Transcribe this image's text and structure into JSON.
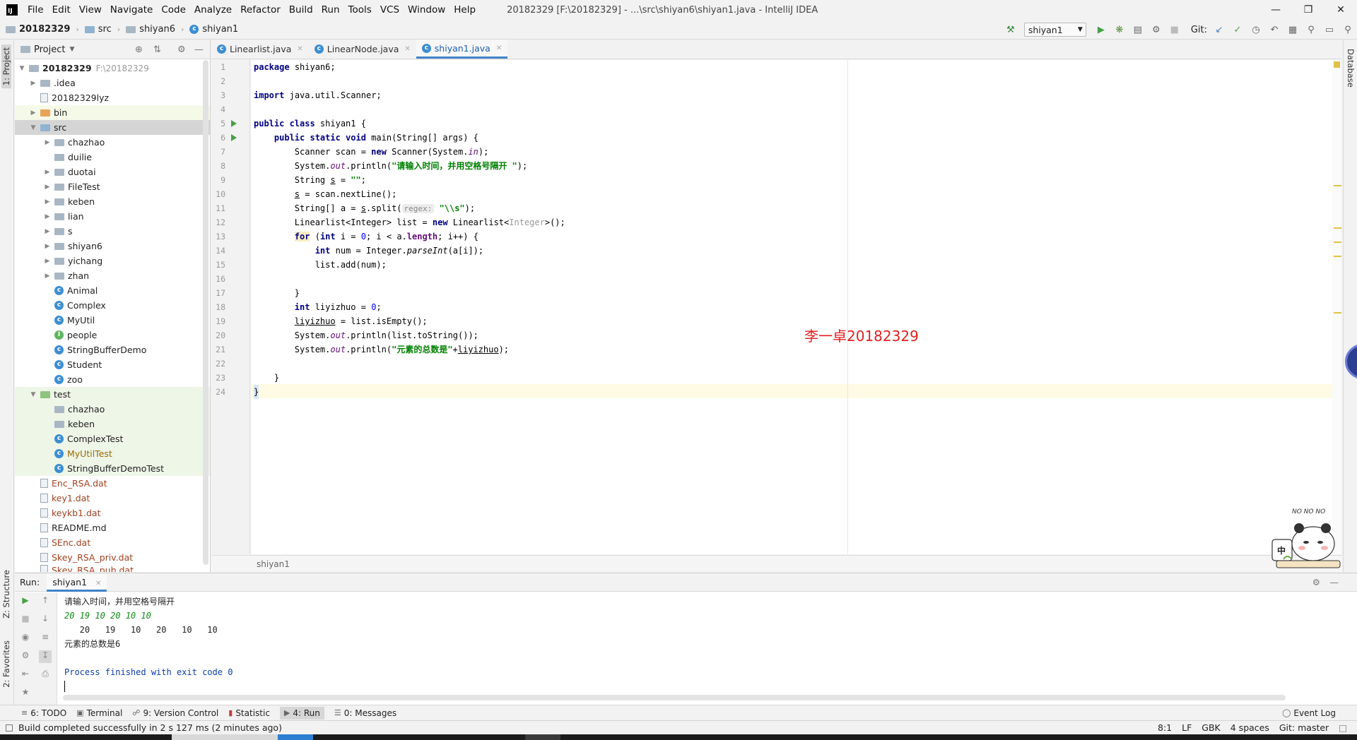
{
  "titlebar": {
    "menu": [
      "File",
      "Edit",
      "View",
      "Navigate",
      "Code",
      "Analyze",
      "Refactor",
      "Build",
      "Run",
      "Tools",
      "VCS",
      "Window",
      "Help"
    ],
    "window_title": "20182329 [F:\\20182329] - ...\\src\\shiyan6\\shiyan1.java - IntelliJ IDEA",
    "logo": "IJ"
  },
  "navbar": {
    "crumbs": [
      "20182329",
      "src",
      "shiyan6",
      "shiyan1"
    ],
    "run_config": "shiyan1",
    "git_label": "Git:"
  },
  "left_stripe": {
    "project_tab": "1: Project",
    "structure_tab": "Z: Structure",
    "favorites_tab": "2: Favorites"
  },
  "right_stripe": {
    "database_tab": "Database"
  },
  "project": {
    "title": "Project",
    "root": "20182329",
    "root_path": "F:\\20182329",
    "items": [
      {
        "label": ".idea",
        "type": "folder"
      },
      {
        "label": "20182329lyz",
        "type": "file"
      },
      {
        "label": "bin",
        "type": "folder-orange"
      },
      {
        "label": "src",
        "type": "folder"
      },
      {
        "label": "chazhao",
        "type": "package"
      },
      {
        "label": "duilie",
        "type": "package"
      },
      {
        "label": "duotai",
        "type": "package"
      },
      {
        "label": "FileTest",
        "type": "package"
      },
      {
        "label": "keben",
        "type": "package"
      },
      {
        "label": "lian",
        "type": "package"
      },
      {
        "label": "s",
        "type": "package"
      },
      {
        "label": "shiyan6",
        "type": "package"
      },
      {
        "label": "yichang",
        "type": "package"
      },
      {
        "label": "zhan",
        "type": "package"
      },
      {
        "label": "Animal",
        "type": "class"
      },
      {
        "label": "Complex",
        "type": "class"
      },
      {
        "label": "MyUtil",
        "type": "class"
      },
      {
        "label": "people",
        "type": "interface"
      },
      {
        "label": "StringBufferDemo",
        "type": "class"
      },
      {
        "label": "Student",
        "type": "class"
      },
      {
        "label": "zoo",
        "type": "class"
      },
      {
        "label": "test",
        "type": "folder-green"
      },
      {
        "label": "chazhao",
        "type": "package"
      },
      {
        "label": "keben",
        "type": "package"
      },
      {
        "label": "ComplexTest",
        "type": "class"
      },
      {
        "label": "MyUtilTest",
        "type": "class"
      },
      {
        "label": "StringBufferDemoTest",
        "type": "class"
      },
      {
        "label": "Enc_RSA.dat",
        "type": "datfile"
      },
      {
        "label": "key1.dat",
        "type": "datfile"
      },
      {
        "label": "keykb1.dat",
        "type": "datfile"
      },
      {
        "label": "README.md",
        "type": "mdfile"
      },
      {
        "label": "SEnc.dat",
        "type": "datfile"
      },
      {
        "label": "Skey_RSA_priv.dat",
        "type": "datfile"
      },
      {
        "label": "Skey_RSA_pub.dat",
        "type": "datfile"
      }
    ]
  },
  "editor": {
    "tabs": [
      "Linearlist.java",
      "LinearNode.java",
      "shiyan1.java"
    ],
    "active_tab": "shiyan1.java",
    "breadcrumb": "shiyan1",
    "watermark": "李一卓20182329",
    "line_numbers": [
      "1",
      "2",
      "3",
      "4",
      "5",
      "6",
      "7",
      "8",
      "9",
      "10",
      "11",
      "12",
      "13",
      "14",
      "15",
      "16",
      "17",
      "18",
      "19",
      "20",
      "21",
      "22",
      "23",
      "24"
    ],
    "code": {
      "l1": "package shiyan6;",
      "l3": "import java.util.Scanner;",
      "l5a": "public class ",
      "l5b": "shiyan1 {",
      "l6a": "    public static void ",
      "l6b": "main(String[] args) {",
      "l7a": "        Scanner scan = ",
      "l7b": "new",
      "l7c": " Scanner(System.",
      "l7d": "in",
      "l7e": ");",
      "l8a": "        System.",
      "l8b": "out",
      "l8c": ".println(",
      "l8d": "\"请输入时间，并用空格号隔开 \"",
      "l8e": ");",
      "l9a": "        String ",
      "l9b": "s",
      "l9c": " = ",
      "l9d": "\"\"",
      "l9e": ";",
      "l10a": "        ",
      "l10b": "s",
      "l10c": " = scan.nextLine();",
      "l11a": "        String[] a = ",
      "l11b": "s",
      "l11c": ".split(",
      "l11d": "regex:",
      "l11e": "\"\\\\s\"",
      "l11f": ");",
      "l12a": "        Linearlist<Integer> list = ",
      "l12b": "new",
      "l12c": " Linearlist<",
      "l12d": "Integer",
      "l12e": ">();",
      "l13a": "        ",
      "l13b": "for",
      "l13c": " (",
      "l13d": "int",
      "l13e": " i = ",
      "l13f": "0",
      "l13g": "; i < a.",
      "l13h": "length",
      "l13i": "; i++) {",
      "l14a": "            ",
      "l14b": "int",
      "l14c": " num = Integer.",
      "l14d": "parseInt",
      "l14e": "(a[i]);",
      "l15": "            list.add(num);",
      "l17": "        }",
      "l18a": "        ",
      "l18b": "int",
      "l18c": " liyizhuo = ",
      "l18d": "0",
      "l18e": ";",
      "l19a": "        ",
      "l19b": "liyizhuo",
      "l19c": " = list.isEmpty();",
      "l20a": "        System.",
      "l20b": "out",
      "l20c": ".println(list.toString());",
      "l21a": "        System.",
      "l21b": "out",
      "l21c": ".println(",
      "l21d": "\"元素的总数是\"",
      "l21e": "+",
      "l21f": "liyizhuo",
      "l21g": ");",
      "l23": "    }",
      "l24": "}"
    }
  },
  "run_panel": {
    "label": "Run:",
    "tab": "shiyan1",
    "console": [
      "请输入时间，并用空格号隔开",
      "20 19 10 20 10 10",
      "   20   19   10   20   10   10",
      "元素的总数是6",
      "",
      "Process finished with exit code 0"
    ]
  },
  "bottom_tabs": [
    "6: TODO",
    "Terminal",
    "9: Version Control",
    "Statistic",
    "4: Run",
    "0: Messages"
  ],
  "event_log": "Event Log",
  "status": {
    "message": "Build completed successfully in 2 s 127 ms (2 minutes ago)",
    "position": "8:1",
    "line_sep": "LF",
    "encoding": "GBK",
    "indent": "4 spaces",
    "vcs": "Git: master"
  },
  "sticker": {
    "text_top": "NO NO NO",
    "badge": "中"
  },
  "colors": {
    "accent": "#4083c9",
    "watermark": "#e02020",
    "run_green": "#47a047"
  }
}
